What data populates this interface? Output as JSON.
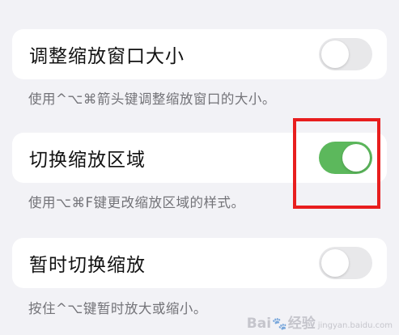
{
  "settings": [
    {
      "label": "调整缩放窗口大小",
      "footer": "使用^⌥⌘箭头键调整缩放窗口的大小。",
      "enabled": false
    },
    {
      "label": "切换缩放区域",
      "footer": "使用⌥⌘F键更改缩放区域的样式。",
      "enabled": true
    },
    {
      "label": "暂时切换缩放",
      "footer": "按住^⌥键暂时放大或缩小。",
      "enabled": false
    }
  ],
  "colors": {
    "toggle_on": "#5cb85c",
    "toggle_off": "#e8e8ea",
    "highlight": "#e81e1e"
  },
  "watermark": {
    "brand_left": "Bai",
    "brand_right": "经验",
    "domain": "jingyan.baidu.com"
  }
}
